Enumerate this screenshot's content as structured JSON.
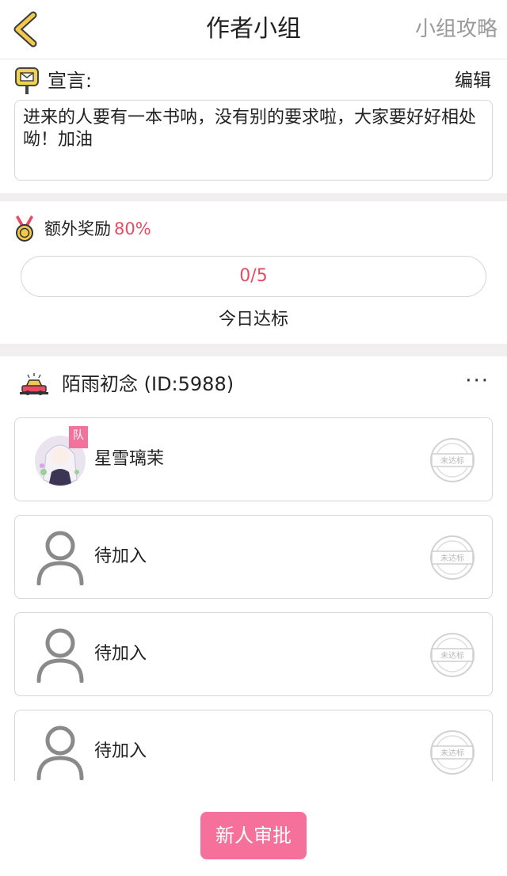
{
  "header": {
    "title": "作者小组",
    "strategy_label": "小组攻略"
  },
  "manifesto": {
    "label": "宣言:",
    "edit_label": "编辑",
    "text": "进来的人要有一本书呐，没有别的要求啦，大家要好好相处呦！加油"
  },
  "reward": {
    "label": "额外奖励",
    "percent": "80%",
    "progress_text": "0/5",
    "progress_fraction": 0,
    "today_label": "今日达标"
  },
  "team": {
    "name": "陌雨初念 (ID:5988)",
    "more_label": "···"
  },
  "members": [
    {
      "name": "星雪璃茉",
      "badge": "队",
      "stamp": "未达标"
    },
    {
      "name": "待加入",
      "stamp": "未达标"
    },
    {
      "name": "待加入",
      "stamp": "未达标"
    },
    {
      "name": "待加入",
      "stamp": "未达标"
    }
  ],
  "footer": {
    "approve_label": "新人审批"
  },
  "colors": {
    "accent_pink": "#f5709b",
    "accent_red_text": "#e84c64",
    "back_arrow": "#f2c94c"
  }
}
